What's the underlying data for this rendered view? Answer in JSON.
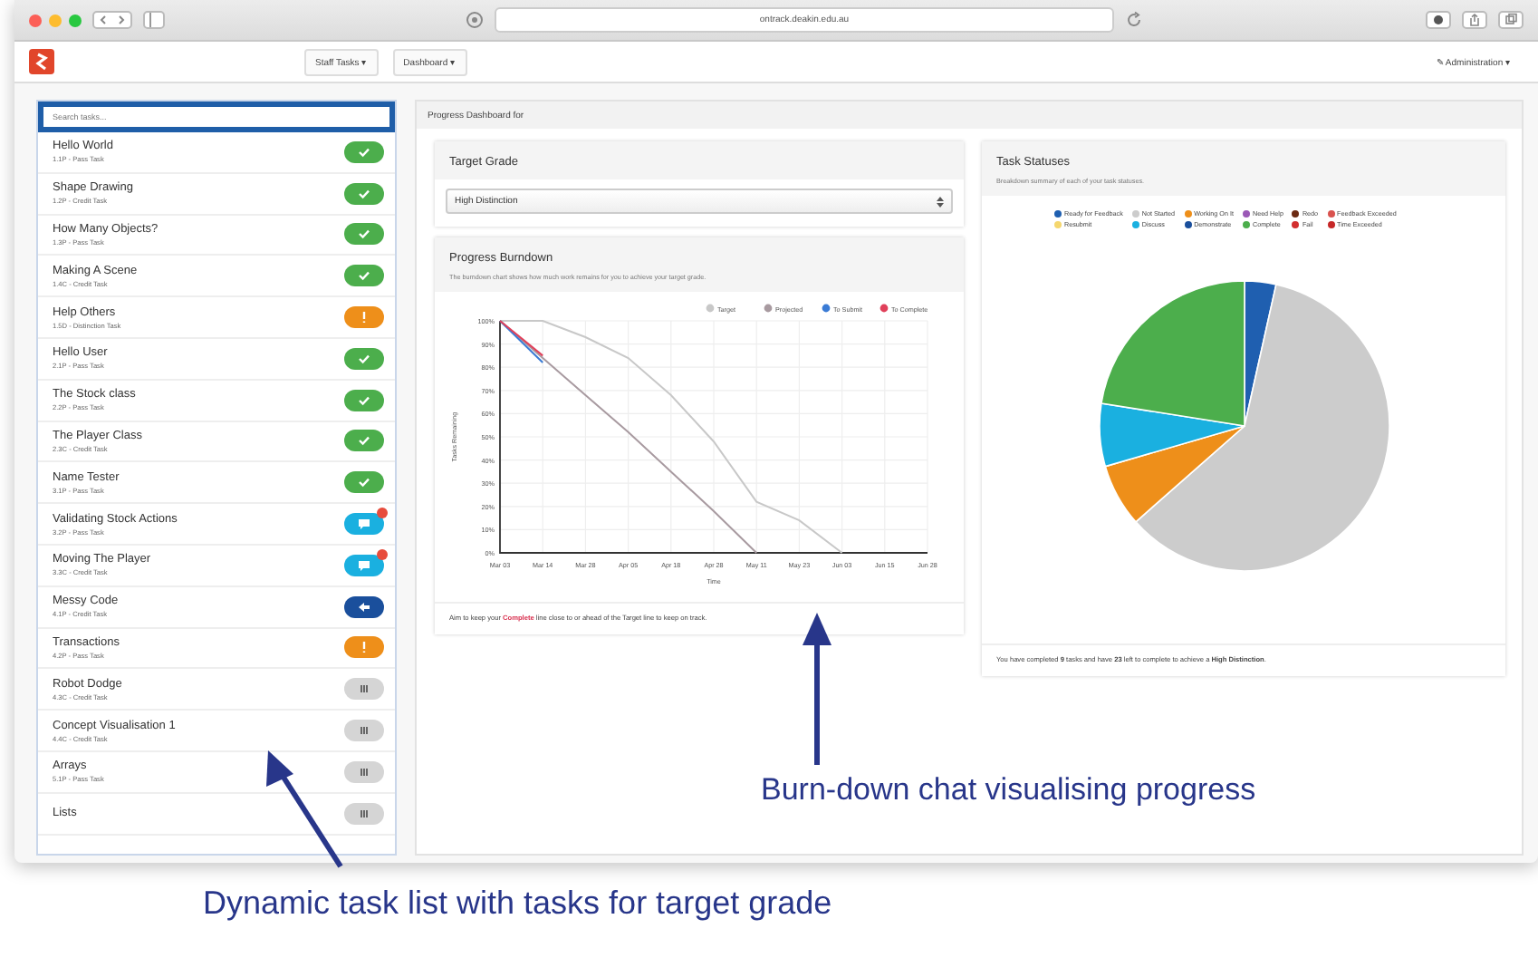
{
  "browser": {
    "url": "ontrack.deakin.edu.au"
  },
  "navbar": {
    "menus": [
      "Staff Tasks ▾",
      "Dashboard ▾"
    ],
    "user_menu": "✎ Administration ▾"
  },
  "sidebar": {
    "search": {
      "placeholder": "Search tasks..."
    },
    "tasks": [
      {
        "name": "Hello World",
        "subtitle": "1.1P - Pass Task",
        "kind": "complete",
        "comment": false
      },
      {
        "name": "Shape Drawing",
        "subtitle": "1.2P - Credit Task",
        "kind": "complete",
        "comment": false
      },
      {
        "name": "How Many Objects?",
        "subtitle": "1.3P - Pass Task",
        "kind": "complete",
        "comment": false
      },
      {
        "name": "Making A Scene",
        "subtitle": "1.4C - Credit Task",
        "kind": "complete",
        "comment": false
      },
      {
        "name": "Help Others",
        "subtitle": "1.5D - Distinction Task",
        "kind": "working",
        "comment": false
      },
      {
        "name": "Hello User",
        "subtitle": "2.1P - Pass Task",
        "kind": "complete",
        "comment": false
      },
      {
        "name": "The Stock class",
        "subtitle": "2.2P - Pass Task",
        "kind": "complete",
        "comment": false
      },
      {
        "name": "The Player Class",
        "subtitle": "2.3C - Credit Task",
        "kind": "complete",
        "comment": false
      },
      {
        "name": "Name Tester",
        "subtitle": "3.1P - Pass Task",
        "kind": "complete",
        "comment": false
      },
      {
        "name": "Validating Stock Actions",
        "subtitle": "3.2P - Pass Task",
        "kind": "discuss",
        "comment": true
      },
      {
        "name": "Moving The Player",
        "subtitle": "3.3C - Credit Task",
        "kind": "discuss",
        "comment": true
      },
      {
        "name": "Messy Code",
        "subtitle": "4.1P - Credit Task",
        "kind": "demonstrate",
        "comment": false
      },
      {
        "name": "Transactions",
        "subtitle": "4.2P - Pass Task",
        "kind": "working",
        "comment": false
      },
      {
        "name": "Robot Dodge",
        "subtitle": "4.3C - Credit Task",
        "kind": "not_started",
        "comment": false
      },
      {
        "name": "Concept Visualisation 1",
        "subtitle": "4.4C - Credit Task",
        "kind": "not_started",
        "comment": false
      },
      {
        "name": "Arrays",
        "subtitle": "5.1P - Pass Task",
        "kind": "not_started",
        "comment": false
      },
      {
        "name": "Lists",
        "kind": "not_started",
        "comment": false
      }
    ]
  },
  "main": {
    "header": "Progress Dashboard for",
    "target_grade": {
      "title": "Target Grade",
      "value": "High Distinction"
    },
    "burndown": {
      "title": "Progress Burndown",
      "subtitle": "The burndown chart shows how much work remains for you to achieve your target grade.",
      "chart_data": {
        "type": "line",
        "xlabel": "Time",
        "ylabel": "Tasks Remaining",
        "ylim": [
          0,
          100
        ],
        "grid": true,
        "legend": true,
        "categories": [
          "Mar 03",
          "Mar 14",
          "Mar 28",
          "Apr 05",
          "Apr 18",
          "Apr 28",
          "May 11",
          "May 23",
          "Jun 03",
          "Jun 15",
          "Jun 28"
        ],
        "yticks": [
          {
            "value": 0,
            "label": "0%"
          },
          {
            "value": 10,
            "label": "10%"
          },
          {
            "value": 20,
            "label": "20%"
          },
          {
            "value": 30,
            "label": "30%"
          },
          {
            "value": 40,
            "label": "40%"
          },
          {
            "value": 50,
            "label": "50%"
          },
          {
            "value": 60,
            "label": "60%"
          },
          {
            "value": 70,
            "label": "70%"
          },
          {
            "value": 80,
            "label": "80%"
          },
          {
            "value": 90,
            "label": "90%"
          },
          {
            "value": 100,
            "label": "100%"
          }
        ],
        "series": [
          {
            "name": "Target",
            "color": "#c8c8c8",
            "values": [
              100,
              100,
              93,
              84,
              68,
              48,
              22,
              14,
              0,
              null,
              null
            ]
          },
          {
            "name": "Projected",
            "color": "#a89aa0",
            "values": [
              100,
              84,
              68,
              52,
              35,
              18,
              0,
              null,
              null,
              null,
              null
            ]
          },
          {
            "name": "To Submit",
            "color": "#3a7bd5",
            "values": [
              100,
              82,
              null,
              null,
              null,
              null,
              null,
              null,
              null,
              null,
              null
            ]
          },
          {
            "name": "To Complete",
            "color": "#e0405a",
            "values": [
              100,
              85,
              null,
              null,
              null,
              null,
              null,
              null,
              null,
              null,
              null
            ]
          }
        ]
      },
      "footer": {
        "before": "Aim to keep your ",
        "highlight": "Complete",
        "after": " line close to or ahead of the Target line to keep on track."
      }
    },
    "task_statuses": {
      "title": "Task Statuses",
      "subtitle": "Breakdown summary of each of your task statuses.",
      "legend": [
        {
          "label": "Ready for Feedback",
          "color": "#1f5fb0"
        },
        {
          "label": "Not Started",
          "color": "#cccccc"
        },
        {
          "label": "Working On It",
          "color": "#ee8f1a"
        },
        {
          "label": "Need Help",
          "color": "#9b59b6"
        },
        {
          "label": "Redo",
          "color": "#6b2a12"
        },
        {
          "label": "Feedback Exceeded",
          "color": "#d9534f"
        },
        {
          "label": "Resubmit",
          "color": "#f5d76e"
        },
        {
          "label": "Discuss",
          "color": "#1ab0e0"
        },
        {
          "label": "Demonstrate",
          "color": "#1a4f9c"
        },
        {
          "label": "Complete",
          "color": "#4cae4c"
        },
        {
          "label": "Fail",
          "color": "#d32f2f"
        },
        {
          "label": "Time Exceeded",
          "color": "#c62828"
        }
      ],
      "footer": "You have completed **9** tasks and have **23** left to complete to achieve a **High Distinction**."
    }
  },
  "annotations": [
    "Burn-down chat visualising progress",
    "Dynamic task list with tasks for target grade"
  ]
}
